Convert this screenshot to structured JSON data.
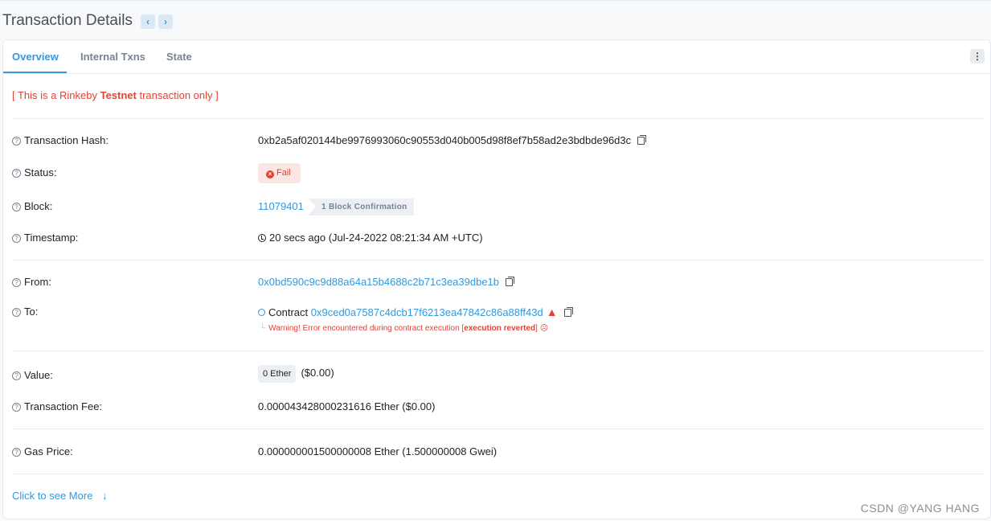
{
  "header": {
    "title": "Transaction Details",
    "prev_label": "‹",
    "next_label": "›"
  },
  "tabs": [
    {
      "label": "Overview",
      "active": true
    },
    {
      "label": "Internal Txns",
      "active": false
    },
    {
      "label": "State",
      "active": false
    }
  ],
  "more_menu_label": "⋮",
  "notice": {
    "prefix": "[ This is a Rinkeby ",
    "bold": "Testnet",
    "suffix": " transaction only ]"
  },
  "fields": {
    "tx_hash": {
      "label": "Transaction Hash:",
      "value": "0xb2a5af020144be9976993060c90553d040b005d98f8ef7b58ad2e3bdbde96d3c"
    },
    "status": {
      "label": "Status:",
      "value": "Fail",
      "icon": "x-circle-icon"
    },
    "block": {
      "label": "Block:",
      "value": "11079401",
      "confirmations": "1 Block Confirmation"
    },
    "timestamp": {
      "label": "Timestamp:",
      "value": "20 secs ago (Jul-24-2022 08:21:34 AM +UTC)"
    },
    "from": {
      "label": "From:",
      "value": "0x0bd590c9c9d88a64a15b4688c2b71c3ea39dbe1b"
    },
    "to": {
      "label": "To:",
      "contract_label": "Contract",
      "value": "0x9ced0a7587c4dcb17f6213ea47842c86a88ff43d",
      "warning_prefix": "Warning! Error encountered during contract execution [",
      "warning_bold": "execution reverted",
      "warning_suffix": "]",
      "warning_face": "☹"
    },
    "value": {
      "label": "Value:",
      "amount": "0 Ether",
      "usd": "($0.00)"
    },
    "tx_fee": {
      "label": "Transaction Fee:",
      "value": "0.000043428000231616 Ether ($0.00)"
    },
    "gas_price": {
      "label": "Gas Price:",
      "value": "0.000000001500000008 Ether (1.500000008 Gwei)"
    }
  },
  "see_more": {
    "label": "Click to see More",
    "arrow": "↓"
  },
  "watermark": "CSDN @YANG HANG",
  "colors": {
    "accent": "#3498db",
    "danger": "#de4437",
    "text": "#1e2022"
  }
}
